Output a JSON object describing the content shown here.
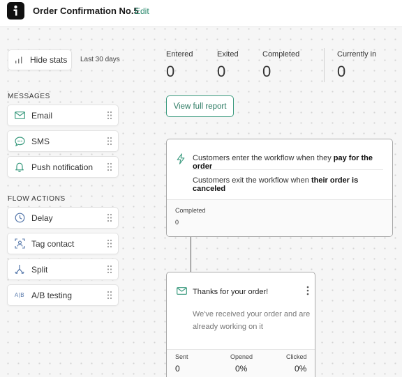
{
  "header": {
    "title": "Order Confirmation No.5",
    "edit_label": "Edit"
  },
  "stats_toggle": {
    "label": "Hide stats",
    "range": "Last 30 days"
  },
  "sidebar": {
    "messages_heading": "MESSAGES",
    "messages": [
      {
        "label": "Email",
        "icon": "envelope-icon"
      },
      {
        "label": "SMS",
        "icon": "chat-bubble-icon"
      },
      {
        "label": "Push notification",
        "icon": "bell-icon"
      }
    ],
    "actions_heading": "FLOW ACTIONS",
    "actions": [
      {
        "label": "Delay",
        "icon": "clock-icon"
      },
      {
        "label": "Tag contact",
        "icon": "tag-contact-icon"
      },
      {
        "label": "Split",
        "icon": "split-icon"
      },
      {
        "label": "A/B testing",
        "icon": "ab-testing-icon",
        "icon_text": "A|B"
      }
    ]
  },
  "stats": [
    {
      "label": "Entered",
      "value": "0"
    },
    {
      "label": "Exited",
      "value": "0"
    },
    {
      "label": "Completed",
      "value": "0"
    },
    {
      "label": "Currently in",
      "value": "0"
    }
  ],
  "report_button": "View full report",
  "trigger": {
    "enter_prefix": "Customers enter the workflow when they ",
    "enter_bold": "pay for the order",
    "exit_prefix": "Customers exit the workflow when ",
    "exit_bold": "their order is canceled",
    "footer_label": "Completed",
    "footer_value": "0"
  },
  "email_node": {
    "title": "Thanks for your order!",
    "body": "We've received your order and are already working on it",
    "metrics": [
      {
        "label": "Sent",
        "value": "0"
      },
      {
        "label": "Opened",
        "value": "0%"
      },
      {
        "label": "Clicked",
        "value": "0%"
      }
    ]
  },
  "colors": {
    "accent": "#2b8a6e",
    "background": "#f6f6f6",
    "card_border": "#a9a9a9"
  }
}
